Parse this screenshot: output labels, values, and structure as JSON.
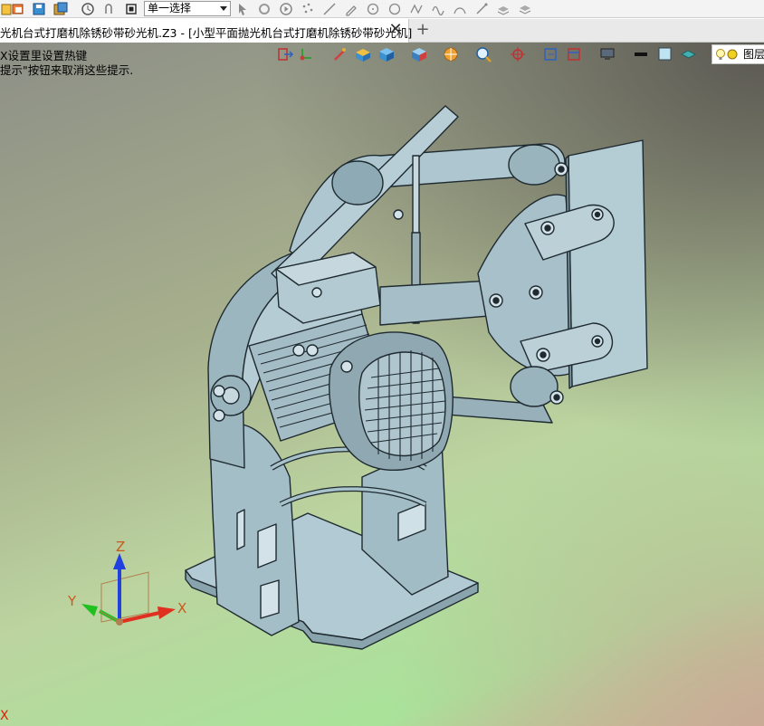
{
  "toolbar": {
    "select_mode_value": "单一选择",
    "icons": [
      "new-file-icon",
      "open-file-icon",
      "save-icon",
      "save-all-icon",
      "history-icon",
      "undo-icon",
      "stop-icon",
      "pointer-icon",
      "grip-icon",
      "play-icon",
      "points-icon",
      "line-icon",
      "pencil-icon",
      "circle-icon",
      "polyline-icon",
      "spline-icon",
      "arc-icon",
      "wand-icon",
      "layers-icon",
      "stack-icon"
    ]
  },
  "tab": {
    "title": "光机台式打磨机除锈砂带砂光机.Z3 - [小型平面抛光机台式打磨机除锈砂带砂光机]",
    "close_glyph": "✕",
    "new_tab_glyph": "+"
  },
  "viewport": {
    "hint_line1": "X设置里设置热键",
    "hint_line2": "提示\"按钮来取消这些提示.",
    "layers_label": "图层",
    "corner_x": "X",
    "view_tool_icons": [
      "exit-icon",
      "axis-toggle-icon",
      "brush-icon",
      "box-icon",
      "cube-icon",
      "view-cube-icon",
      "wheel-icon",
      "zoom-icon",
      "crosshair-icon",
      "refresh-icon",
      "frame-icon",
      "monitor-icon",
      "line-style-icon",
      "color-swatch-icon",
      "surface-icon",
      "bulb-icon"
    ]
  },
  "axis": {
    "x_label": "X",
    "y_label": "Y",
    "z_label": "Z"
  },
  "colors": {
    "part_fill": "#a8c2cc",
    "part_stroke": "#1e2a30",
    "axis_x": "#e03020",
    "axis_y": "#20c020",
    "axis_z": "#2040e0"
  }
}
